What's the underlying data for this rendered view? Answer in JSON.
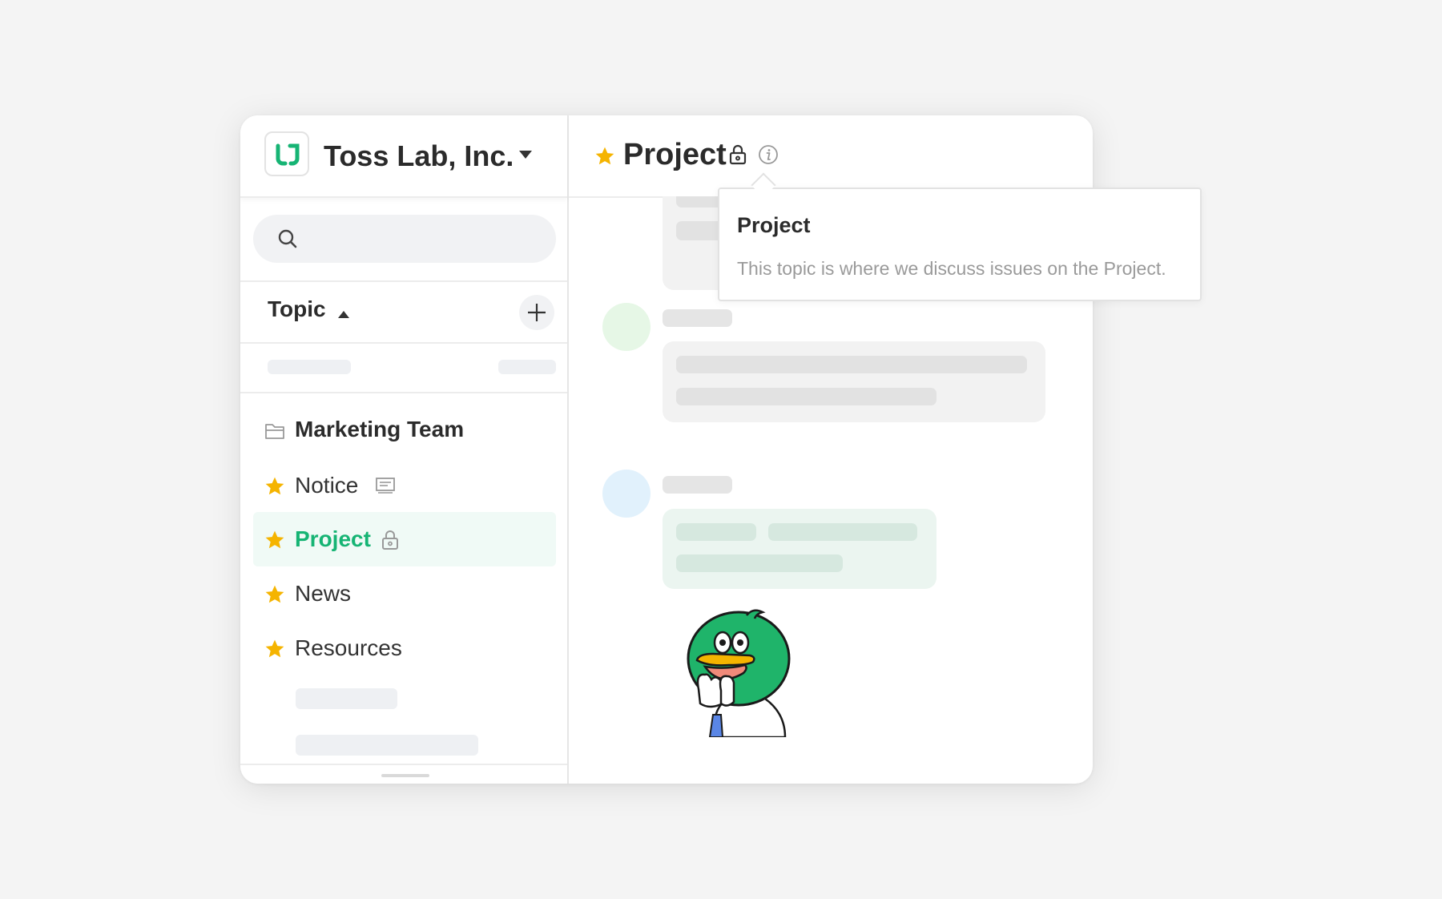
{
  "workspace": {
    "name": "Toss Lab, Inc."
  },
  "sidebar": {
    "section_label": "Topic",
    "folder": {
      "name": "Marketing Team"
    },
    "topics": [
      {
        "label": "Notice",
        "starred": true,
        "aux_icon": "announcement-icon"
      },
      {
        "label": "Project",
        "starred": true,
        "aux_icon": "lock-icon",
        "active": true
      },
      {
        "label": "News",
        "starred": true
      },
      {
        "label": "Resources",
        "starred": true
      }
    ]
  },
  "main": {
    "title": "Project"
  },
  "tooltip": {
    "title": "Project",
    "description": "This topic is where we discuss issues on the Project."
  },
  "colors": {
    "accent_green": "#16b474",
    "star_yellow": "#f5b400",
    "active_bg": "#f0faf6"
  }
}
